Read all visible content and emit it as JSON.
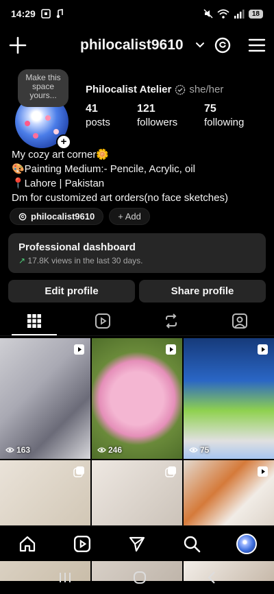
{
  "status_bar": {
    "time": "14:29",
    "battery": "18"
  },
  "header": {
    "username": "philocalist9610"
  },
  "note": {
    "text": "Make this space yours..."
  },
  "profile": {
    "display_name": "Philocalist Atelier",
    "pronouns": "she/her",
    "stats": [
      {
        "value": "41",
        "label": "posts"
      },
      {
        "value": "121",
        "label": "followers"
      },
      {
        "value": "75",
        "label": "following"
      }
    ],
    "bio": [
      "My cozy art corner🌼",
      "🎨Painting Medium:- Pencile, Acrylic, oil",
      "📍Lahore | Pakistan",
      "Dm for customized art orders(no face sketches)"
    ]
  },
  "chips": {
    "threads_handle": "philocalist9610",
    "add_label": "+ Add"
  },
  "dashboard": {
    "title": "Professional dashboard",
    "arrow": "↗",
    "subtitle": "17.8K views in the last 30 days."
  },
  "buttons": {
    "edit": "Edit profile",
    "share": "Share profile"
  },
  "tabs": [
    "grid-icon",
    "reels-icon",
    "reposts-icon",
    "tagged-icon"
  ],
  "grid": [
    {
      "views": "163",
      "badge": "reel"
    },
    {
      "views": "246",
      "badge": "reel"
    },
    {
      "views": "75",
      "badge": "reel"
    },
    {
      "views": "",
      "badge": "carousel"
    },
    {
      "views": "",
      "badge": "carousel"
    },
    {
      "views": "",
      "badge": "reel"
    }
  ],
  "bottom_nav": [
    "home-icon",
    "reels-icon",
    "send-icon",
    "search-icon",
    "profile-avatar"
  ]
}
